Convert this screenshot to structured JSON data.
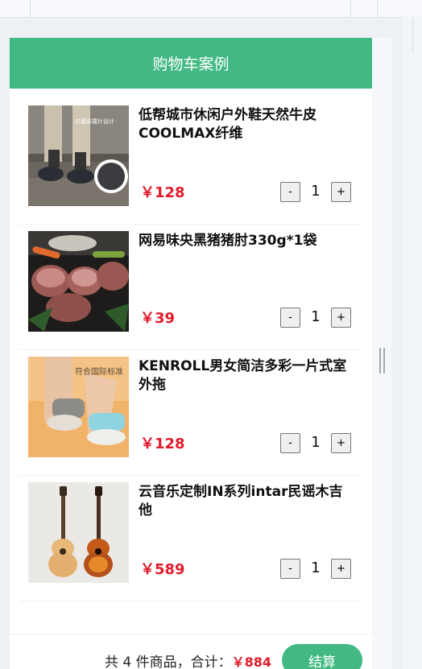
{
  "header": {
    "title": "购物车案例"
  },
  "currency": "￥",
  "items": [
    {
      "name": "低帮城市休闲户外鞋天然牛皮COOLMAX纤维",
      "price": "￥128",
      "count": "1",
      "image": "shoes-image"
    },
    {
      "name": "网易味央黑猪猪肘330g*1袋",
      "price": "￥39",
      "count": "1",
      "image": "pork-image"
    },
    {
      "name": "KENROLL男女简洁多彩一片式室外拖",
      "price": "￥128",
      "count": "1",
      "image": "slippers-image"
    },
    {
      "name": "云音乐定制IN系列intar民谣木吉他",
      "price": "￥589",
      "count": "1",
      "image": "guitars-image"
    }
  ],
  "controls": {
    "minus": "-",
    "plus": "+"
  },
  "footer": {
    "summary_prefix": "共 4 件商品，合计：",
    "total": "￥884",
    "checkout_label": "结算"
  },
  "image_texts": {
    "shoes": "内置防撞片设计",
    "slippers": "符合国际标准"
  },
  "colors": {
    "accent": "#42b983",
    "price": "#e21b2b"
  }
}
